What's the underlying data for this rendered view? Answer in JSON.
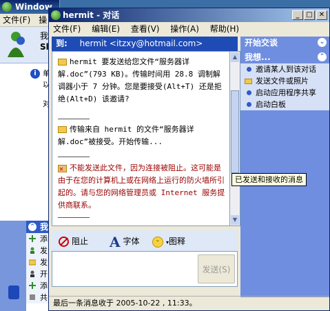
{
  "bg_window": {
    "title": "Window",
    "menu": [
      "文件(F)",
      "操"
    ],
    "user_line1": "我",
    "user_line2": "Sl",
    "info_line1": "单",
    "info_line2": "以",
    "info_line3": "对",
    "task_header": "我",
    "tasks": [
      "添",
      "发",
      "发",
      "开",
      "添",
      "共"
    ]
  },
  "chat": {
    "title": "hermit - 对话",
    "menu": [
      "文件(F)",
      "编辑(E)",
      "查看(V)",
      "操作(A)",
      "帮助(H)"
    ],
    "to_label": "到:",
    "to_value": "hermit <itzxy@hotmail.com>",
    "messages": [
      "hermit 要发送给您文件“服务器详解.doc”(793 KB)。传输时间用 28.8 调制解调器小于 7 分钟。您是要接受(Alt+T) 还是拒绝(Alt+D) 该邀请?",
      "传输来自 hermit 的文件“服务器详解.doc”被接受。开始传输...",
      "不能发送此文件，因为连接被阻止。这可能是由于在您的计算机上或在网络上运行的防火墙所引起的。请与您的网络管理员或 Internet 服务提供商联系。"
    ],
    "toolbar": {
      "block": "阻止",
      "font": "字体",
      "emoticon": "图释"
    },
    "send_label": "发送(S)",
    "status": "最后一条消息收于 2005-10-22 , 11:33。",
    "tooltip": "已发送和接收的消息"
  },
  "side_panel": {
    "start_head": "开始交谈",
    "want_head": "我想...",
    "items": [
      "邀请某人到该对话",
      "发送文件或照片",
      "启动应用程序共享",
      "启动白板"
    ]
  },
  "icons": [
    "folder-icon",
    "blocked-icon",
    "font-icon",
    "smile-icon",
    "chevron-up-icon"
  ],
  "colors": {
    "titlebar": "#0a246a",
    "to_bar": "#1f4bb4",
    "side_panel": "#6f8ee0",
    "error_text": "#990000"
  }
}
